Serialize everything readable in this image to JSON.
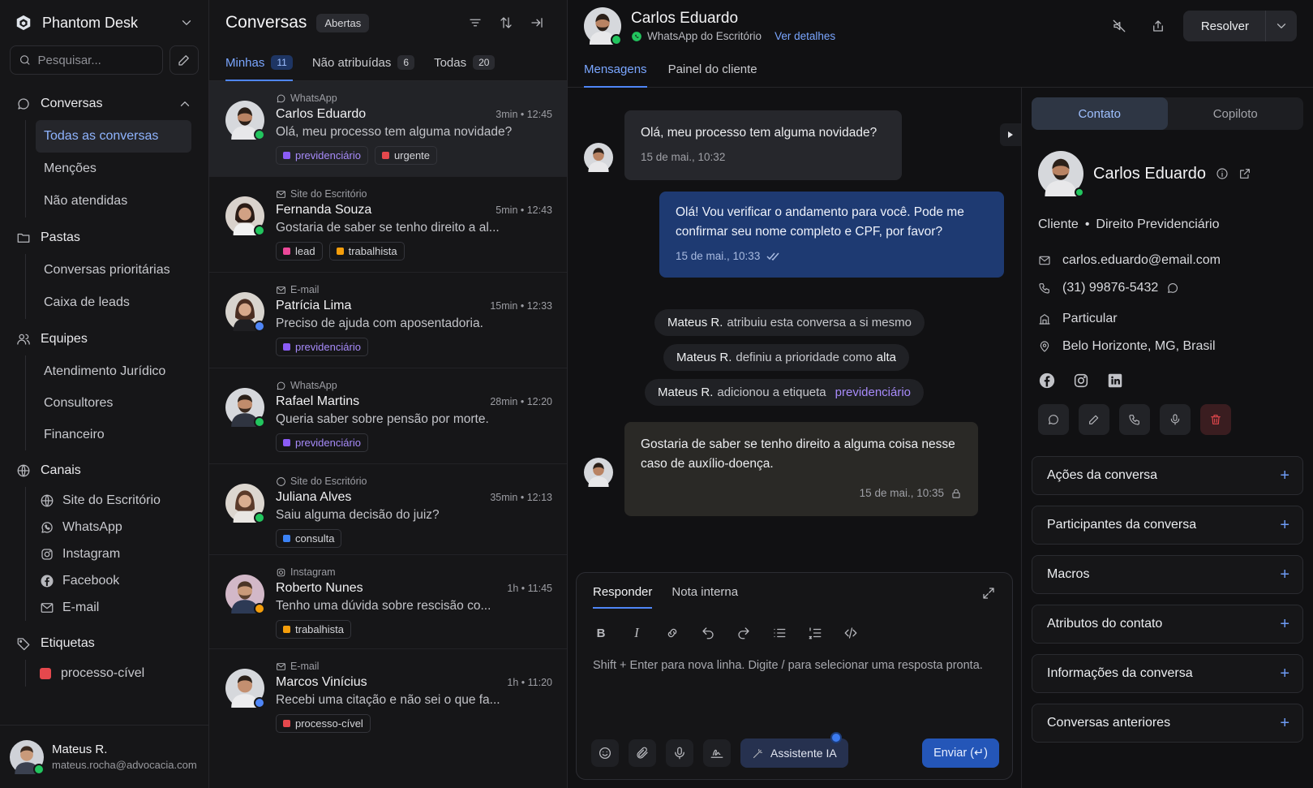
{
  "brand": {
    "name": "Phantom Desk"
  },
  "sidebar": {
    "search_placeholder": "Pesquisar...",
    "conversas": {
      "label": "Conversas",
      "items": [
        "Todas as conversas",
        "Menções",
        "Não atendidas"
      ]
    },
    "pastas": {
      "label": "Pastas",
      "items": [
        "Conversas prioritárias",
        "Caixa de leads"
      ]
    },
    "equipes": {
      "label": "Equipes",
      "items": [
        "Atendimento Jurídico",
        "Consultores",
        "Financeiro"
      ]
    },
    "canais": {
      "label": "Canais",
      "items": [
        "Site do Escritório",
        "WhatsApp",
        "Instagram",
        "Facebook",
        "E-mail"
      ]
    },
    "etiquetas": {
      "label": "Etiquetas",
      "items": [
        "processo-cível"
      ]
    },
    "user": {
      "name": "Mateus R.",
      "email": "mateus.rocha@advocacia.com"
    }
  },
  "list": {
    "title": "Conversas",
    "status": "Abertas",
    "tabs": [
      {
        "label": "Minhas",
        "count": "11"
      },
      {
        "label": "Não atribuídas",
        "count": "6"
      },
      {
        "label": "Todas",
        "count": "20"
      }
    ],
    "conversations": [
      {
        "channel": "WhatsApp",
        "name": "Carlos Eduardo",
        "time": "3min • 12:45",
        "preview": "Olá, meu processo tem alguma novidade?",
        "tags": [
          "previdenciário",
          "urgente"
        ]
      },
      {
        "channel": "Site do Escritório",
        "name": "Fernanda Souza",
        "time": "5min • 12:43",
        "preview": "Gostaria de saber se tenho direito a al...",
        "tags": [
          "lead",
          "trabalhista"
        ]
      },
      {
        "channel": "E-mail",
        "name": "Patrícia Lima",
        "time": "15min • 12:33",
        "preview": "Preciso de ajuda com aposentadoria.",
        "tags": [
          "previdenciário"
        ]
      },
      {
        "channel": "WhatsApp",
        "name": "Rafael Martins",
        "time": "28min • 12:20",
        "preview": "Queria saber sobre pensão por morte.",
        "tags": [
          "previdenciário"
        ]
      },
      {
        "channel": "Site do Escritório",
        "name": "Juliana Alves",
        "time": "35min • 12:13",
        "preview": "Saiu alguma decisão do juiz?",
        "tags": [
          "consulta"
        ]
      },
      {
        "channel": "Instagram",
        "name": "Roberto Nunes",
        "time": "1h • 11:45",
        "preview": "Tenho uma dúvida sobre rescisão co...",
        "tags": [
          "trabalhista"
        ]
      },
      {
        "channel": "E-mail",
        "name": "Marcos Vinícius",
        "time": "1h • 11:20",
        "preview": "Recebi uma citação e não sei o que fa...",
        "tags": [
          "processo-cível"
        ]
      }
    ]
  },
  "chat": {
    "name": "Carlos Eduardo",
    "inbox": "WhatsApp do Escritório",
    "details_link": "Ver detalhes",
    "resolve": "Resolver",
    "tabs": [
      "Mensagens",
      "Painel do cliente"
    ],
    "messages": {
      "m1": {
        "text": "Olá, meu processo tem alguma novidade?",
        "ts": "15 de mai., 10:32"
      },
      "m2": {
        "text": "Olá! Vou verificar o andamento para você. Pode me confirmar seu nome completo e CPF, por favor?",
        "ts": "15 de mai., 10:33"
      },
      "a1": {
        "who": "Mateus R.",
        "text": "atribuiu esta conversa a si mesmo"
      },
      "a2": {
        "who": "Mateus R.",
        "text": "definiu a prioridade como",
        "value": "alta"
      },
      "a3": {
        "who": "Mateus R.",
        "text": "adicionou a etiqueta",
        "value": "previdenciário"
      },
      "m3": {
        "text": "Gostaria de saber se tenho direito a alguma coisa nesse caso de auxílio-doença.",
        "ts": "15 de mai., 10:35"
      }
    },
    "composer": {
      "tabs": [
        "Responder",
        "Nota interna"
      ],
      "placeholder": "Shift + Enter para nova linha. Digite / para selecionar uma resposta pronta.",
      "ai_label": "Assistente IA",
      "send_label": "Enviar (↵)"
    }
  },
  "contact": {
    "tabs": [
      "Contato",
      "Copiloto"
    ],
    "name": "Carlos Eduardo",
    "role": "Cliente",
    "area": "Direito Previdenciário",
    "email": "carlos.eduardo@email.com",
    "phone": "(31) 99876-5432",
    "company": "Particular",
    "location": "Belo Horizonte, MG, Brasil",
    "sections": [
      "Ações da conversa",
      "Participantes da conversa",
      "Macros",
      "Atributos do contato",
      "Informações da conversa",
      "Conversas anteriores"
    ]
  },
  "colors": {
    "accent": "#4f86f7",
    "outgoing": "#1e3a72",
    "online": "#22c55e",
    "danger": "#e5484d"
  }
}
